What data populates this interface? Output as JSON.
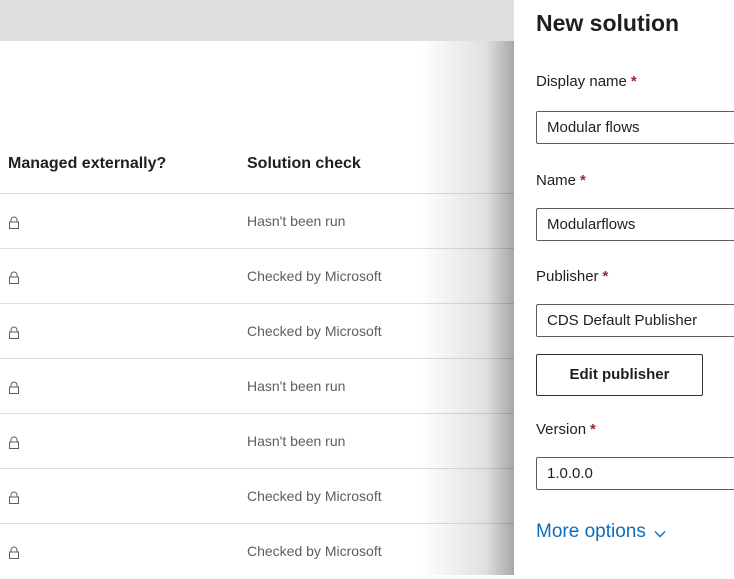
{
  "list": {
    "columns": {
      "managed_externally": "Managed externally?",
      "solution_check": "Solution check"
    },
    "rows": [
      {
        "managed_icon": "lock-icon",
        "solution_check": "Hasn't been run"
      },
      {
        "managed_icon": "lock-icon",
        "solution_check": "Checked by Microsoft"
      },
      {
        "managed_icon": "lock-icon",
        "solution_check": "Checked by Microsoft"
      },
      {
        "managed_icon": "lock-icon",
        "solution_check": "Hasn't been run"
      },
      {
        "managed_icon": "lock-icon",
        "solution_check": "Hasn't been run"
      },
      {
        "managed_icon": "lock-icon",
        "solution_check": "Checked by Microsoft"
      },
      {
        "managed_icon": "lock-icon",
        "solution_check": "Checked by Microsoft"
      }
    ]
  },
  "panel": {
    "title": "New solution",
    "required_marker": "*",
    "display_name": {
      "label": "Display name",
      "value": "Modular flows"
    },
    "name": {
      "label": "Name",
      "value": "Modularflows"
    },
    "publisher": {
      "label": "Publisher",
      "value": "CDS Default Publisher"
    },
    "edit_publisher_label": "Edit publisher",
    "version": {
      "label": "Version",
      "value": "1.0.0.0"
    },
    "more_options_label": "More options",
    "more_options_icon": "chevron-down-icon"
  },
  "colors": {
    "accent_link": "#0f6cbd",
    "required": "#a4262c",
    "topbar": "#e1dfdd"
  }
}
